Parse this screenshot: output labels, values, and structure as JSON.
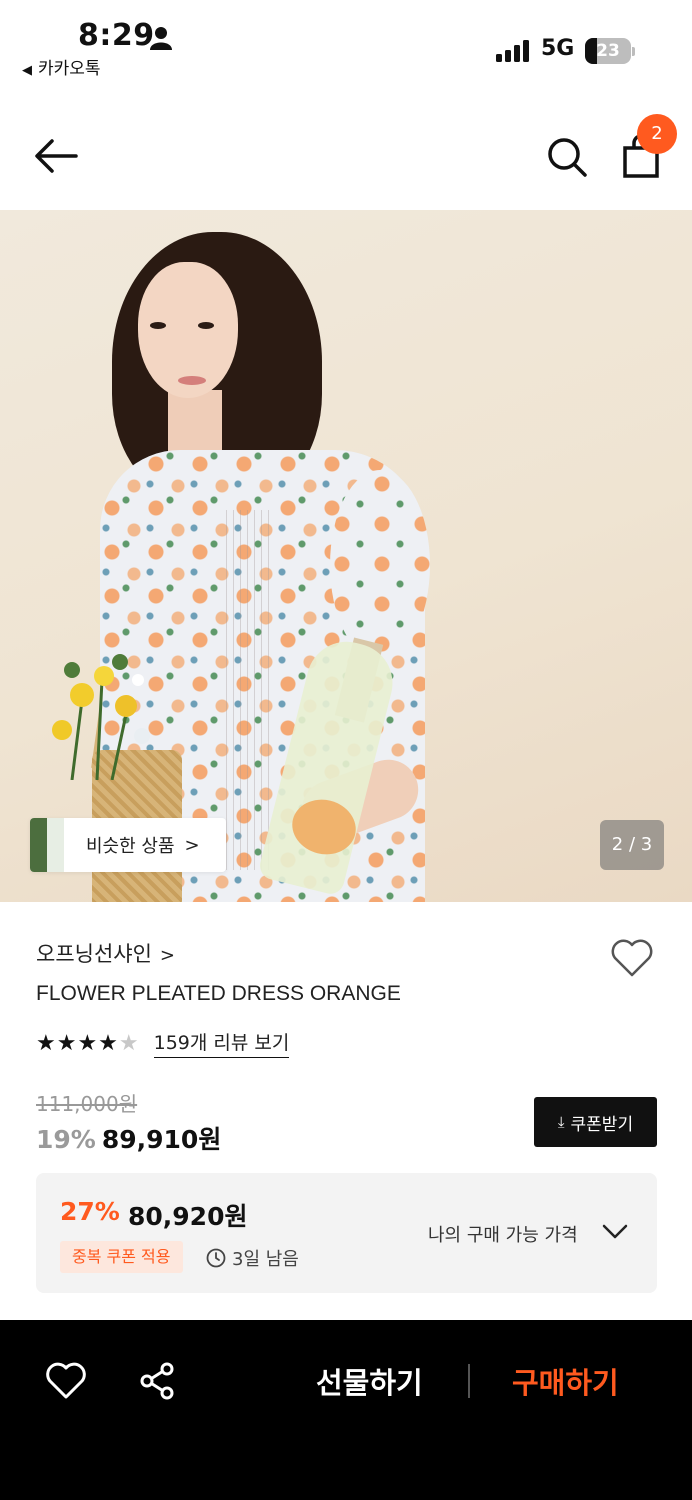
{
  "status_bar": {
    "time": "8:29",
    "back_app": "카카오톡",
    "network": "5G",
    "battery": "23"
  },
  "header": {
    "cart_count": "2"
  },
  "gallery": {
    "similar_label": "비슷한 상품",
    "page_indicator": "2 / 3"
  },
  "product": {
    "brand": "오프닝선샤인",
    "name": "FLOWER PLEATED DRESS ORANGE",
    "rating": 4.5,
    "review_link": "159개 리뷰 보기",
    "original_price": "111,000원",
    "discount_pct": "19%",
    "price": "89,910원",
    "coupon_button": "쿠폰받기"
  },
  "my_price": {
    "discount_pct": "27%",
    "price": "80,920원",
    "tag": "중복 쿠폰 적용",
    "time_left": "3일 남음",
    "label": "나의 구매 가능 가격"
  },
  "bottom_bar": {
    "gift_label": "선물하기",
    "buy_label": "구매하기"
  },
  "colors": {
    "accent": "#ff5a1f",
    "bar_bg": "#000000"
  }
}
